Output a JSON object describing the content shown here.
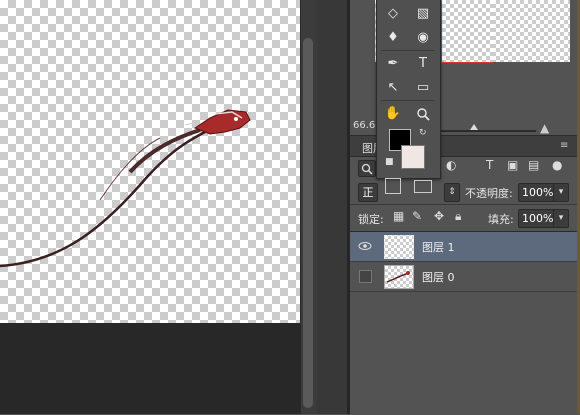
{
  "navigator": {
    "zoom": "66.67"
  },
  "layers_panel": {
    "tab_label": "图层",
    "panel_menu_icon": "panel-menu-icon",
    "filter_icons": [
      "image-filter-icon",
      "adjustment-filter-icon",
      "type-filter-icon",
      "shape-filter-icon",
      "smart-object-filter-icon",
      "toggle-filter-icon"
    ],
    "blend_mode": "正",
    "opacity_label": "不透明度:",
    "opacity_value": "100%",
    "lock_label": "锁定:",
    "lock_icons": [
      "lock-transparent-icon",
      "lock-image-icon",
      "lock-position-icon",
      "lock-all-icon"
    ],
    "fill_label": "填充:",
    "fill_value": "100%",
    "layers": [
      {
        "name": "图层 1",
        "visible": true,
        "selected": true
      },
      {
        "name": "图层 0",
        "visible": false,
        "selected": false
      }
    ]
  },
  "tools": [
    "eraser-icon",
    "gradient-icon",
    "blur-icon",
    "dodge-icon",
    "pen-icon",
    "type-icon",
    "path-selection-icon",
    "rectangle-icon",
    "hand-icon",
    "zoom-icon"
  ],
  "colors": {
    "foreground": "#000000",
    "background": "#f0e6e4",
    "selected_layer": "#5d6a7d"
  }
}
